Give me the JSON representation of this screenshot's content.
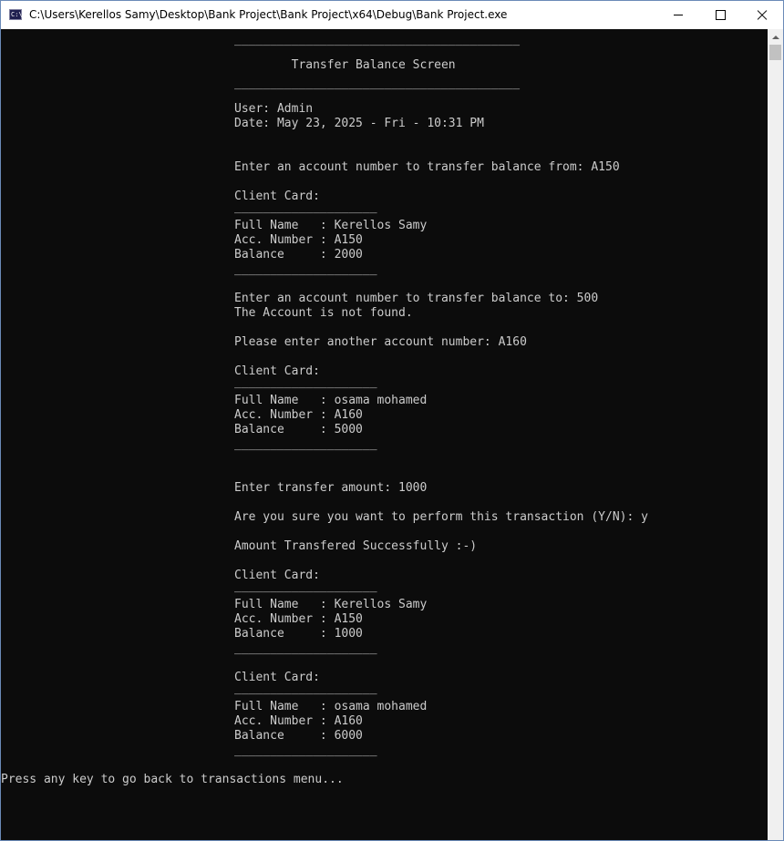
{
  "window": {
    "title": "C:\\Users\\Kerellos Samy\\Desktop\\Bank Project\\Bank Project\\x64\\Debug\\Bank Project.exe",
    "icon_text": "C:\\"
  },
  "console": {
    "lines": [
      "________________________________________",
      "        Transfer Balance Screen",
      "________________________________________",
      "User: Admin",
      "Date: May 23, 2025 - Fri - 10:31 PM",
      "Enter an account number to transfer balance from: A150",
      "Client Card:",
      "____________________",
      "Full Name   : Kerellos Samy",
      "Acc. Number : A150",
      "Balance     : 2000",
      "____________________",
      "Enter an account number to transfer balance to: 500",
      "The Account is not found.",
      "Please enter another account number: A160",
      "Client Card:",
      "____________________",
      "Full Name   : osama mohamed",
      "Acc. Number : A160",
      "Balance     : 5000",
      "____________________",
      "Enter transfer amount: 1000",
      "Are you sure you want to perform this transaction (Y/N): y",
      "Amount Transfered Successfully :-)",
      "Client Card:",
      "____________________",
      "Full Name   : Kerellos Samy",
      "Acc. Number : A150",
      "Balance     : 1000",
      "____________________",
      "Client Card:",
      "____________________",
      "Full Name   : osama mohamed",
      "Acc. Number : A160",
      "Balance     : 6000",
      "____________________",
      "Press any key to go back to transactions menu..."
    ]
  }
}
